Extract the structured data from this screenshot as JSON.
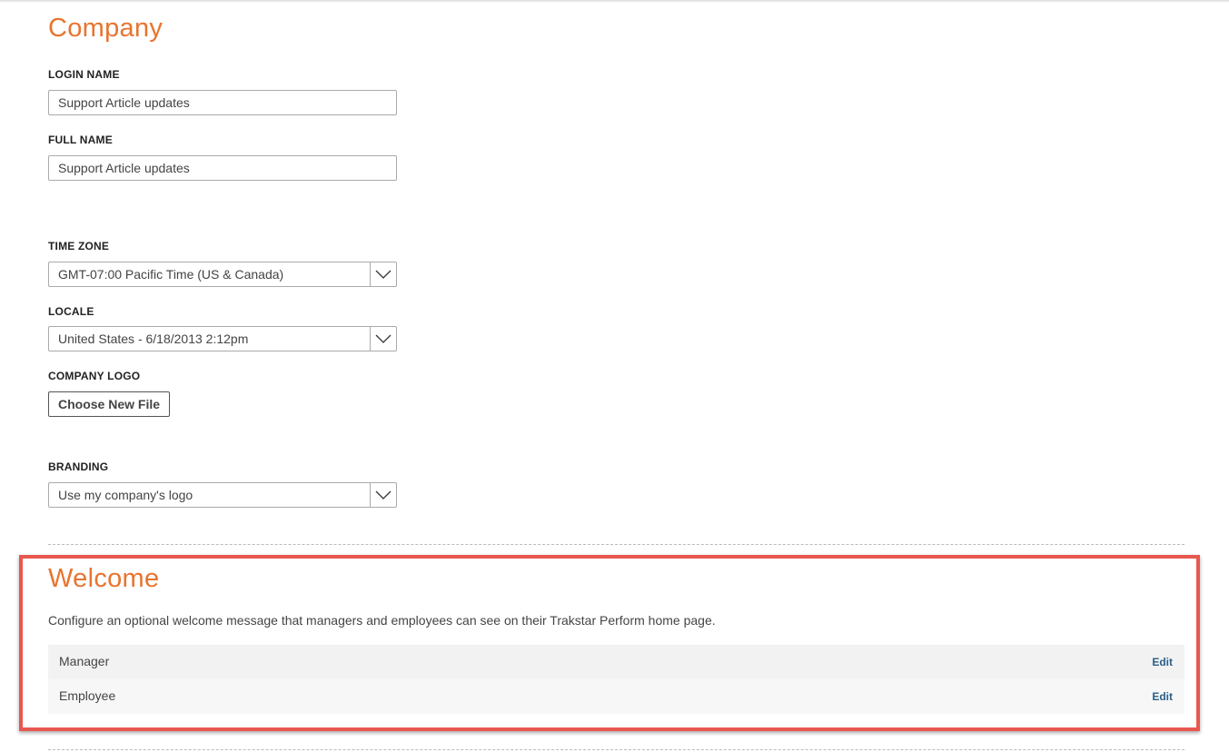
{
  "company": {
    "title": "Company",
    "login_name": {
      "label": "LOGIN NAME",
      "value": "Support Article updates"
    },
    "full_name": {
      "label": "FULL NAME",
      "value": "Support Article updates"
    },
    "time_zone": {
      "label": "TIME ZONE",
      "selected": "GMT-07:00 Pacific Time (US & Canada)"
    },
    "locale": {
      "label": "LOCALE",
      "selected": "United States - 6/18/2013 2:12pm"
    },
    "company_logo": {
      "label": "COMPANY LOGO",
      "button_label": "Choose New File"
    },
    "branding": {
      "label": "BRANDING",
      "selected": "Use my company's logo"
    }
  },
  "welcome": {
    "title": "Welcome",
    "description": "Configure an optional welcome message that managers and employees can see on their Trakstar Perform home page.",
    "rows": [
      {
        "name": "Manager",
        "action": "Edit"
      },
      {
        "name": "Employee",
        "action": "Edit"
      }
    ]
  },
  "colors": {
    "heading": "#e8742e",
    "highlight_border": "#e8584f",
    "edit_link": "#2a5f8a"
  },
  "icons": {
    "dropdown": "chevron-down-icon"
  }
}
